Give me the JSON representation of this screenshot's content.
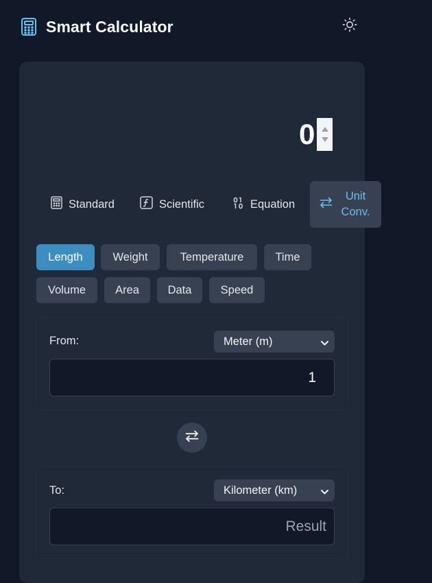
{
  "app": {
    "title": "Smart Calculator",
    "icon": "calculator-icon",
    "theme_icon": "sun-icon"
  },
  "display": {
    "value": "0"
  },
  "modes": [
    {
      "label": "Standard",
      "icon": "calculator-icon"
    },
    {
      "label": "Scientific",
      "icon": "function-icon"
    },
    {
      "label": "Equation",
      "icon": "binary-icon"
    },
    {
      "label": "Unit Conv.",
      "icon": "swap-icon",
      "active": true
    }
  ],
  "unit_categories": [
    "Length",
    "Weight",
    "Temperature",
    "Time",
    "Volume",
    "Area",
    "Data",
    "Speed"
  ],
  "active_category": "Length",
  "from": {
    "label": "From:",
    "unit": "Meter (m)",
    "value": "1"
  },
  "to": {
    "label": "To:",
    "unit": "Kilometer (km)",
    "placeholder": "Result"
  },
  "colors": {
    "background": "#111827",
    "card": "#1f2937",
    "button": "#374151",
    "accent": "#3b8ec0",
    "accent_text": "#60c4f0"
  }
}
